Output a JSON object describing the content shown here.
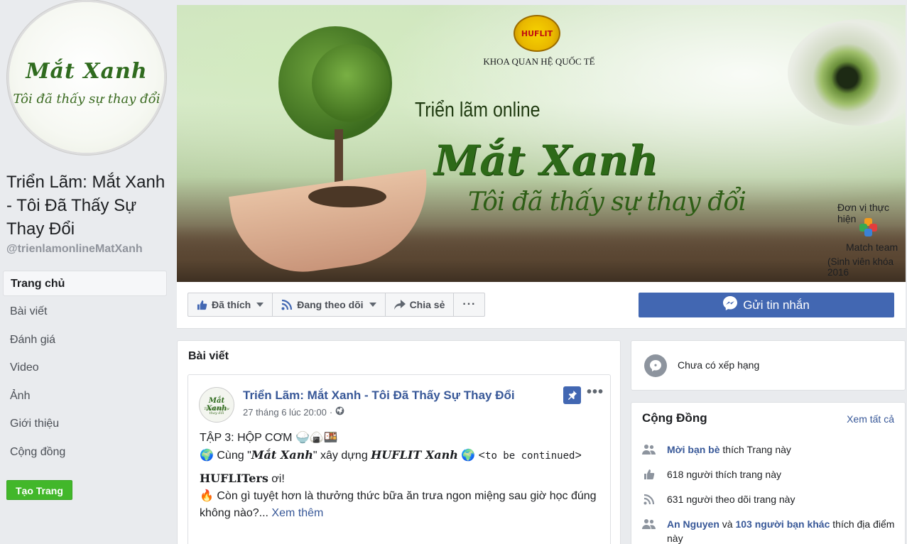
{
  "profile": {
    "avatar_title": "Mắt Xanh",
    "avatar_subtitle": "Tôi đã thấy sự thay đổi",
    "name": "Triển Lãm: Mắt Xanh - Tôi Đã Thấy Sự Thay Đổi",
    "handle": "@trienlamonlineMatXanh"
  },
  "nav": [
    {
      "label": "Trang chủ",
      "active": true
    },
    {
      "label": "Bài viết"
    },
    {
      "label": "Đánh giá"
    },
    {
      "label": "Video"
    },
    {
      "label": "Ảnh"
    },
    {
      "label": "Giới thiệu"
    },
    {
      "label": "Cộng đồng"
    }
  ],
  "create_page_label": "Tạo Trang",
  "cover": {
    "logo_text": "HUFLIT",
    "department": "KHOA QUAN HỆ QUỐC TẾ",
    "kicker": "Triển lãm online",
    "title": "Mắt Xanh",
    "subtitle": "Tôi đã thấy sự thay đổi",
    "org_label": "Đơn vị thực hiện",
    "team": "Match team",
    "team_note": "(Sinh viên khóa 2016"
  },
  "actions": {
    "liked": "Đã thích",
    "following": "Đang theo dõi",
    "share": "Chia sẻ",
    "more": "···",
    "message": "Gửi tin nhắn"
  },
  "posts": {
    "heading": "Bài viết",
    "author": "Triển Lãm: Mắt Xanh - Tôi Đã Thấy Sự Thay Đổi",
    "avatar_title": "Mắt Xanh",
    "avatar_subtitle": "Tôi đã thấy sự thay đổi",
    "timestamp": "27 tháng 6 lúc 20:00",
    "separator": "·",
    "more_dots": "•••",
    "line1": "TẬP 3: HỘP CƠM 🍚🍙🍱",
    "line2_pre": "🌍 Cùng \"",
    "line2_brand": "Mắt Xanh",
    "line2_mid": "\" xây dựng ",
    "line2_brand2": "HUFLIT Xanh",
    "line2_post": " 🌍 <",
    "line2_mono": "to be continued",
    "line2_end": ">",
    "line3_bold": "HUFLITers",
    "line3_rest": " ơi!",
    "line4": "🔥 Còn gì tuyệt hơn là thưởng thức bữa ăn trưa ngon miệng sau giờ học đúng không nào?...",
    "see_more": "Xem thêm"
  },
  "rating": {
    "text": "Chưa có xếp hạng"
  },
  "community": {
    "title": "Cộng Đồng",
    "see_all": "Xem tất cả",
    "invite_link": "Mời bạn bè",
    "invite_rest": "thích Trang này",
    "likes": "618 người thích trang này",
    "follows": "631 người theo dõi trang này",
    "friend_name": "An Nguyen",
    "friend_and": "và",
    "friend_others": "103 người bạn khác",
    "friend_rest": "thích địa điểm này"
  },
  "colors": {
    "facebook_blue": "#4267b2",
    "link": "#385898",
    "green_button": "#42b72a",
    "page_bg": "#e9ebee"
  }
}
